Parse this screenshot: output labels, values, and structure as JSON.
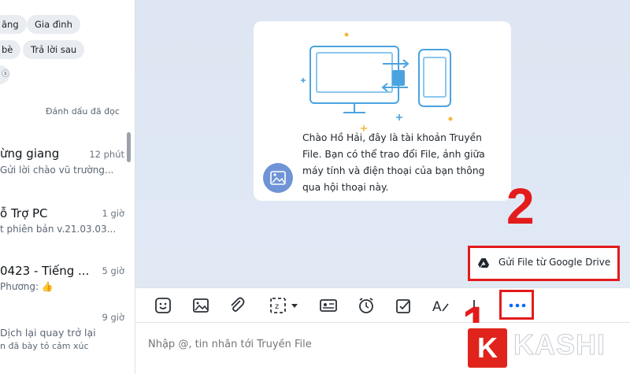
{
  "sidebar": {
    "tags": [
      "ăng",
      "Gia đình",
      "bè",
      "Trả lời sau"
    ],
    "mark_read": "Đánh dấu đã đọc",
    "conversations": [
      {
        "name": "ừng giang",
        "time": "12 phút",
        "preview": "Gửi lời chào vũ trường..."
      },
      {
        "name": "ỗ Trợ PC",
        "time": "1 giờ",
        "preview": "t phiên bản v.21.03.03..."
      },
      {
        "name": "0423 - Tiếng ...",
        "time": "5 giờ",
        "preview": "Phương: 👍"
      },
      {
        "name": "",
        "time": "9 giờ",
        "preview": "Dịch lại quay trở lại",
        "preview2": "n đã bày tỏ cảm xúc"
      }
    ]
  },
  "chat": {
    "info_text": "Chào Hồ Hải, đây là tài khoản Truyền File. Bạn có thể trao đổi File, ảnh giữa máy tính và điện thoại của bạn thông qua hội thoại này.",
    "gdrive_label": "Gửi File từ Google Drive",
    "step_2": "2",
    "step_1": "1",
    "compose_placeholder": "Nhập @, tin nhắn tới Truyền File"
  },
  "toolbar": {
    "icons": [
      "sticker-icon",
      "image-icon",
      "attachment-icon",
      "screenshot-icon",
      "contact-card-icon",
      "reminder-icon",
      "todo-icon",
      "format-text-icon",
      "more-icon"
    ]
  },
  "logo": {
    "letter": "K",
    "text": "KASHI"
  },
  "colors": {
    "accent": "#e31b1b",
    "brand_blue": "#0068ff",
    "illus_blue": "#4aa3e0"
  }
}
